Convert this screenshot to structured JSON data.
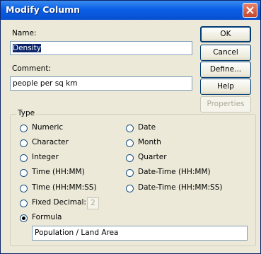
{
  "window": {
    "title": "Modify Column"
  },
  "fields": {
    "name_label": "Name:",
    "name_value": "Density",
    "comment_label": "Comment:",
    "comment_value": "people per sq km"
  },
  "buttons": {
    "ok": "OK",
    "cancel": "Cancel",
    "define": "Define...",
    "help": "Help",
    "properties": "Properties"
  },
  "type_group": {
    "label": "Type",
    "left": [
      "Numeric",
      "Character",
      "Integer",
      "Time (HH:MM)",
      "Time (HH:MM:SS)",
      "Fixed Decimal:",
      "Formula"
    ],
    "right": [
      "Date",
      "Month",
      "Quarter",
      "Date-Time (HH:MM)",
      "Date-Time (HH:MM:SS)"
    ],
    "selected": "Formula",
    "fixed_decimal_value": "2",
    "formula_value": "Population / Land Area"
  },
  "colors": {
    "title_bar": "#0a5fe6",
    "dialog_bg": "#ece9d8",
    "selection": "#0a246a"
  }
}
